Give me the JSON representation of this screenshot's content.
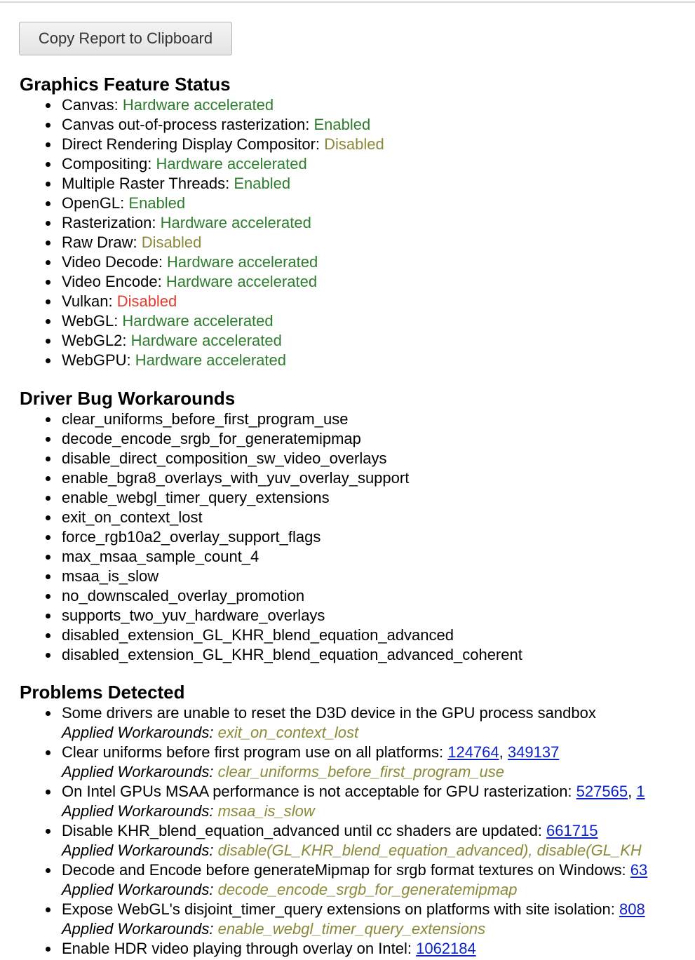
{
  "toolbar": {
    "copy_label": "Copy Report to Clipboard"
  },
  "colors": {
    "enabled": "#2d7d2d",
    "software_or_disabled": "#8a8a3a",
    "disabled": "#e33b2e",
    "link": "#0b22c8"
  },
  "features": {
    "title": "Graphics Feature Status",
    "items": [
      {
        "name": "Canvas",
        "sep": ": ",
        "status": "Hardware accelerated",
        "level": "green"
      },
      {
        "name": "Canvas out-of-process rasterization",
        "sep": ": ",
        "status": "Enabled",
        "level": "green"
      },
      {
        "name": "Direct Rendering Display Compositor",
        "sep": ": ",
        "status": "Disabled",
        "level": "olive"
      },
      {
        "name": "Compositing",
        "sep": ": ",
        "status": "Hardware accelerated",
        "level": "green"
      },
      {
        "name": "Multiple Raster Threads",
        "sep": ": ",
        "status": "Enabled",
        "level": "green"
      },
      {
        "name": "OpenGL",
        "sep": ": ",
        "status": "Enabled",
        "level": "green"
      },
      {
        "name": "Rasterization",
        "sep": ": ",
        "status": "Hardware accelerated",
        "level": "green"
      },
      {
        "name": "Raw Draw",
        "sep": ": ",
        "status": "Disabled",
        "level": "olive"
      },
      {
        "name": "Video Decode",
        "sep": ": ",
        "status": "Hardware accelerated",
        "level": "green"
      },
      {
        "name": "Video Encode",
        "sep": ": ",
        "status": "Hardware accelerated",
        "level": "green"
      },
      {
        "name": "Vulkan",
        "sep": ": ",
        "status": "Disabled",
        "level": "red"
      },
      {
        "name": "WebGL",
        "sep": ": ",
        "status": "Hardware accelerated",
        "level": "green"
      },
      {
        "name": "WebGL2",
        "sep": ": ",
        "status": "Hardware accelerated",
        "level": "green"
      },
      {
        "name": "WebGPU",
        "sep": ": ",
        "status": "Hardware accelerated",
        "level": "green"
      }
    ]
  },
  "workarounds": {
    "title": "Driver Bug Workarounds",
    "items": [
      "clear_uniforms_before_first_program_use",
      "decode_encode_srgb_for_generatemipmap",
      "disable_direct_composition_sw_video_overlays",
      "enable_bgra8_overlays_with_yuv_overlay_support",
      "enable_webgl_timer_query_extensions",
      "exit_on_context_lost",
      "force_rgb10a2_overlay_support_flags",
      "max_msaa_sample_count_4",
      "msaa_is_slow",
      "no_downscaled_overlay_promotion",
      "supports_two_yuv_hardware_overlays",
      "disabled_extension_GL_KHR_blend_equation_advanced",
      "disabled_extension_GL_KHR_blend_equation_advanced_coherent"
    ]
  },
  "problems": {
    "title": "Problems Detected",
    "applied_label": "Applied Workarounds:",
    "items": [
      {
        "text": "Some drivers are unable to reset the D3D device in the GPU process sandbox",
        "links": [],
        "workarounds": "exit_on_context_lost"
      },
      {
        "text": "Clear uniforms before first program use on all platforms:",
        "links": [
          "124764",
          "349137"
        ],
        "workarounds": "clear_uniforms_before_first_program_use"
      },
      {
        "text": "On Intel GPUs MSAA performance is not acceptable for GPU rasterization:",
        "links": [
          "527565",
          "1"
        ],
        "workarounds": "msaa_is_slow"
      },
      {
        "text": "Disable KHR_blend_equation_advanced until cc shaders are updated:",
        "links": [
          "661715"
        ],
        "workarounds": "disable(GL_KHR_blend_equation_advanced), disable(GL_KH"
      },
      {
        "text": "Decode and Encode before generateMipmap for srgb format textures on Windows:",
        "links": [
          "63"
        ],
        "workarounds": "decode_encode_srgb_for_generatemipmap"
      },
      {
        "text": "Expose WebGL's disjoint_timer_query extensions on platforms with site isolation:",
        "links": [
          "808"
        ],
        "workarounds": "enable_webgl_timer_query_extensions"
      },
      {
        "text": "Enable HDR video playing through overlay on Intel:",
        "links": [
          "1062184"
        ],
        "workarounds": ""
      }
    ]
  }
}
